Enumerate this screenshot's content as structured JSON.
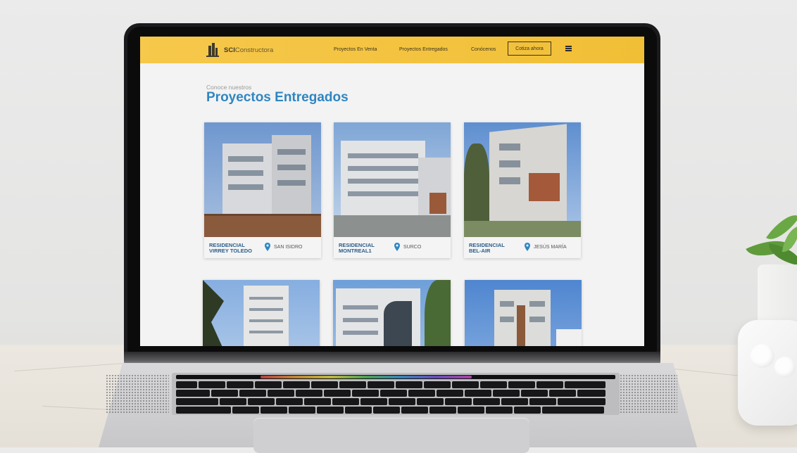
{
  "site": {
    "logo_bold": "SCI",
    "logo_rest": "Constructora"
  },
  "nav": {
    "links": [
      "Proyectos En Venta",
      "Proyectos Entregados",
      "Conócenos"
    ],
    "cta_label": "Cotiza ahora"
  },
  "header": {
    "eyebrow": "Conoce nuestros",
    "title": "Proyectos Entregados"
  },
  "projects": [
    {
      "name_line1": "RESIDENCIAL",
      "name_line2": "VIRREY TOLEDO",
      "location": "SAN ISIDRO"
    },
    {
      "name_line1": "RESIDENCIAL",
      "name_line2": "MONTREAL1",
      "location": "SURCO"
    },
    {
      "name_line1": "RESIDENCIAL",
      "name_line2": "BEL-AIR",
      "location": "JESÚS MARÍA"
    }
  ],
  "icons": {
    "pin": "location-pin-icon",
    "menu": "hamburger-menu-icon",
    "logo": "building-logo-icon"
  },
  "colors": {
    "nav_bg": "#f4c541",
    "title_blue": "#2f86c2",
    "card_name_blue": "#2a5d8a"
  }
}
